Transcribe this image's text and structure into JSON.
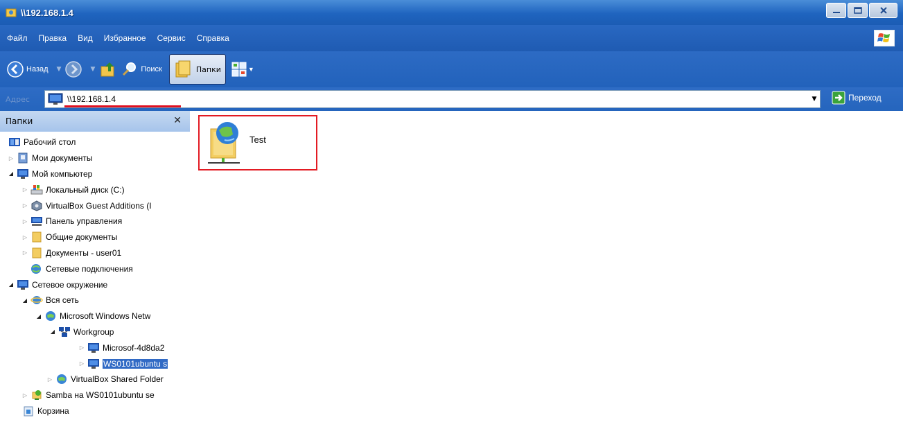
{
  "window": {
    "title": "\\\\192.168.1.4"
  },
  "menu": [
    "Файл",
    "Правка",
    "Вид",
    "Избранное",
    "Сервис",
    "Справка"
  ],
  "toolbar": {
    "back_label": "Назад",
    "search_label": "Поиск",
    "folders_label": "Папки"
  },
  "address": {
    "label": "Адрес",
    "value": "\\\\192.168.1.4",
    "go_label": "Переход"
  },
  "folder_pane": {
    "title": "Папки",
    "tree": [
      {
        "label": "Рабочий стол",
        "icon": "desktop-icon"
      },
      {
        "label": "Мои документы",
        "icon": "my-documents-icon"
      },
      {
        "label": "Мой компьютер",
        "icon": "computer-icon"
      },
      {
        "label": "Локальный диск (C:)",
        "icon": "local-disk-icon"
      },
      {
        "label": "VirtualBox Guest Additions (I",
        "icon": "cd-drive-icon"
      },
      {
        "label": "Панель управления",
        "icon": "control-panel-icon"
      },
      {
        "label": "Общие документы",
        "icon": "folder-icon"
      },
      {
        "label": "Документы - user01",
        "icon": "folder-icon"
      },
      {
        "label": "Сетевые подключения",
        "icon": "network-connections-icon"
      },
      {
        "label": "Сетевое окружение",
        "icon": "network-places-icon"
      },
      {
        "label": "Вся сеть",
        "icon": "entire-network-icon"
      },
      {
        "label": "Microsoft Windows Netw",
        "icon": "windows-network-icon"
      },
      {
        "label": "Workgroup",
        "icon": "workgroup-icon"
      },
      {
        "label": "Microsof-4d8da2",
        "icon": "computer-icon"
      },
      {
        "label": "WS0101ubuntu s",
        "icon": "computer-icon"
      },
      {
        "label": "VirtualBox Shared Folder",
        "icon": "shared-folders-network-icon"
      },
      {
        "label": "Samba на WS0101ubuntu se",
        "icon": "samba-share-icon"
      },
      {
        "label": "Корзина",
        "icon": "recycle-bin-icon"
      }
    ]
  },
  "content": {
    "items": [
      {
        "label": "Test",
        "icon": "network-share-folder-icon"
      }
    ]
  },
  "colors": {
    "title_bar": "#1f64bf",
    "selection": "#316ac5",
    "highlight_border": "#e31b23"
  }
}
